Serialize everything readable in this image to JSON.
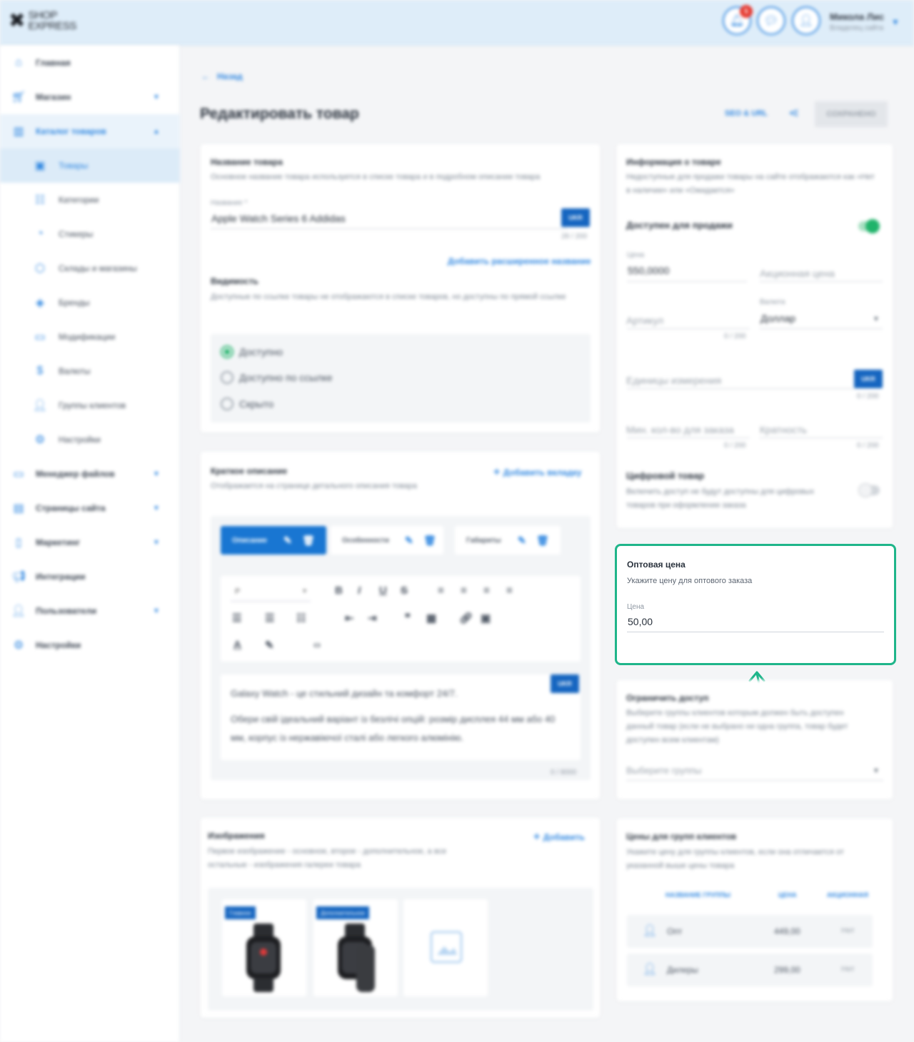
{
  "brand": {
    "line1": "SHOP",
    "line2": "EXPRESS"
  },
  "header": {
    "notifications_count": "5",
    "user_name": "Микола Лис",
    "user_role": "Владелец сайта"
  },
  "sidebar": {
    "items": [
      {
        "label": "Главная",
        "icon": "home-icon"
      },
      {
        "label": "Магазин",
        "icon": "cart-icon"
      },
      {
        "label": "Каталог товаров",
        "icon": "catalog-icon"
      },
      {
        "label": "Товары",
        "icon": "product-icon"
      },
      {
        "label": "Категории",
        "icon": "categories-icon"
      },
      {
        "label": "Стикеры",
        "icon": "sticker-icon"
      },
      {
        "label": "Склады и магазины",
        "icon": "warehouse-icon"
      },
      {
        "label": "Бренды",
        "icon": "brand-icon"
      },
      {
        "label": "Модификации",
        "icon": "modification-icon"
      },
      {
        "label": "Валюты",
        "icon": "currency-icon"
      },
      {
        "label": "Группы клиентов",
        "icon": "client-group-icon"
      },
      {
        "label": "Настройки",
        "icon": "settings-icon"
      },
      {
        "label": "Менеджер файлов",
        "icon": "folder-icon"
      },
      {
        "label": "Страницы сайта",
        "icon": "pages-icon"
      },
      {
        "label": "Маркетинг",
        "icon": "marketing-icon"
      },
      {
        "label": "Интеграции",
        "icon": "integration-icon"
      },
      {
        "label": "Пользователи",
        "icon": "users-icon"
      },
      {
        "label": "Настройки",
        "icon": "settings-icon"
      }
    ]
  },
  "page": {
    "back": "Назад",
    "title": "Редактировать товар",
    "seo_link": "SEO & URL",
    "save": "СОХРАНЕНО"
  },
  "name_card": {
    "title": "Название товара",
    "desc": "Основное название товара используется в списке товара и в подробном описании товара",
    "field_label": "Название *",
    "field_value": "Apple Watch Series 6 Addidas",
    "lang": "UKR",
    "counter": "28 / 200",
    "ext_link": "Добавить расширенное название",
    "visibility_title": "Видимость",
    "visibility_desc": "Доступные по ссылке товары не отображаются в списке товаров, но доступны по прямой ссылке",
    "options": [
      "Доступно",
      "Доступно по ссылке",
      "Скрыто"
    ]
  },
  "short_desc": {
    "title": "Краткое описание",
    "desc": "Отображается на странице детального описания товара",
    "add_tab": "Добавить вкладку",
    "tabs": [
      "Описание",
      "Особенности",
      "Габариты"
    ],
    "format": "P",
    "lang": "UKR",
    "text1": "Galaxy Watch - це стильний дизайн та комфорт 24/7.",
    "text2": "Обери свій ідеальний варіант із безлічі опцій: розмір дисплея 44 мм або 40 мм, корпус із нержавіючої сталі або легкого алюмінію.",
    "counter": "0 / 8000"
  },
  "images": {
    "title": "Изображения",
    "desc": "Первое изображение - основное, второе - дополнительное, а все остальные - изображения галереи товара",
    "add": "Добавить",
    "badges": [
      "Главное",
      "Дополнительное"
    ]
  },
  "info": {
    "title": "Информация о товаре",
    "desc": "Недоступные для продажи товары на сайте отображаются как «Нет в наличии» или «Ожидается»",
    "available": "Доступен для продажи",
    "price_label": "Цена",
    "price": "550,0000",
    "promo": "Акционная цена",
    "article": "Артикул",
    "art_counter": "0 / 200",
    "currency_label": "Валюта",
    "currency": "Доллар",
    "unit": "Единицы измерения",
    "unit_counter": "0 / 200",
    "lang": "UKR",
    "min_qty": "Мин. кол-во для заказа",
    "min_counter": "0 / 200",
    "multiplicity": "Кратность",
    "mult_counter": "0 / 200",
    "digital_title": "Цифровой товар",
    "digital_desc": "Включить доступ не будут доступны для цифровых товаров при оформлении заказа"
  },
  "wholesale": {
    "title": "Оптовая цена",
    "desc": "Укажите цену для оптового заказа",
    "price_label": "Цена",
    "price": "50,00"
  },
  "restrict": {
    "title": "Ограничить доступ",
    "desc": "Выберите группы клиентов которым должен быть доступен данный товар (если не выбрано ни одна группа, товар будет доступен всем клиентам)",
    "placeholder": "Выберите группы"
  },
  "group_prices": {
    "title": "Цены для групп клиентов",
    "desc": "Укажите цену для группы клиентов, если она отличается от указанной выше цены товара",
    "columns": [
      "НАЗВАНИЕ ГРУППЫ",
      "ЦЕНА",
      "АКЦИОННАЯ"
    ],
    "rows": [
      {
        "name": "Опт",
        "price": "449,00",
        "promo": "Нет"
      },
      {
        "name": "Дилеры",
        "price": "299,00",
        "promo": "Нет"
      }
    ]
  },
  "colors": {
    "accent": "#2e86e0",
    "highlight": "#1fb58a",
    "toggle_on": "#20b36a"
  }
}
